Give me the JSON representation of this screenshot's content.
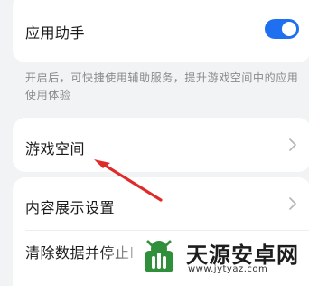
{
  "assistant_row": {
    "label": "应用助手",
    "toggle_on": true
  },
  "assistant_desc": "开启后，可快捷使用辅助服务，提升游戏空间中的应用使用体验",
  "game_space_row": {
    "label": "游戏空间"
  },
  "content_display_row": {
    "label": "内容展示设置"
  },
  "clear_data_row": {
    "label": "清除数据并停止l"
  },
  "watermark": {
    "title": "天源安卓网",
    "url": "www.jytyaz.com"
  },
  "colors": {
    "accent": "#1f6ff1",
    "annotation": "#e02a2a",
    "background": "#f1f3f5"
  },
  "icons": [
    "chevron-right-icon",
    "arrow-annotation-icon",
    "watermark-logo-icon"
  ]
}
